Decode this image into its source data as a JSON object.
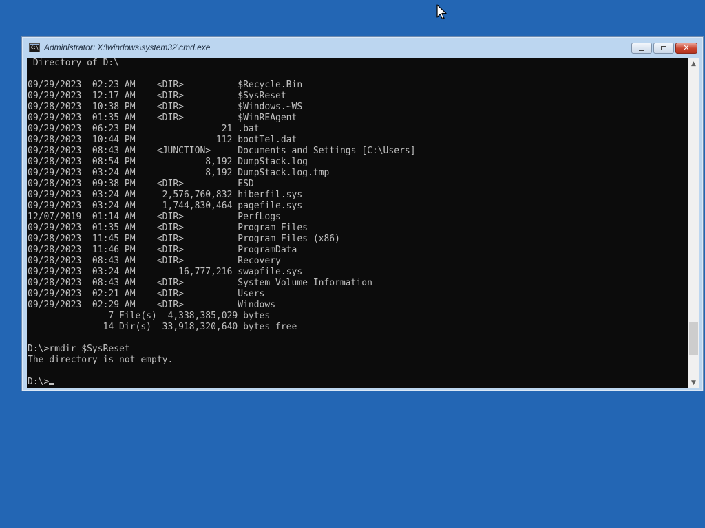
{
  "window": {
    "title": "Administrator: X:\\windows\\system32\\cmd.exe",
    "icon": "cmd-icon",
    "icon_text": "C:\\"
  },
  "controls": {
    "minimize_icon": "minimize-icon",
    "maximize_icon": "maximize-icon",
    "close_icon": "close-icon",
    "close_glyph": "✕"
  },
  "scrollbar": {
    "up": "▲",
    "down": "▼",
    "position_fraction": 0.92
  },
  "console": {
    "lines": [
      " Directory of D:\\",
      "",
      "09/29/2023  02:23 AM    <DIR>          $Recycle.Bin",
      "09/29/2023  12:17 AM    <DIR>          $SysReset",
      "09/28/2023  10:38 PM    <DIR>          $Windows.~WS",
      "09/29/2023  01:35 AM    <DIR>          $WinREAgent",
      "09/29/2023  06:23 PM                21 .bat",
      "09/28/2023  10:44 PM               112 bootTel.dat",
      "09/28/2023  08:43 AM    <JUNCTION>     Documents and Settings [C:\\Users]",
      "09/28/2023  08:54 PM             8,192 DumpStack.log",
      "09/29/2023  03:24 AM             8,192 DumpStack.log.tmp",
      "09/28/2023  09:38 PM    <DIR>          ESD",
      "09/29/2023  03:24 AM     2,576,760,832 hiberfil.sys",
      "09/29/2023  03:24 AM     1,744,830,464 pagefile.sys",
      "12/07/2019  01:14 AM    <DIR>          PerfLogs",
      "09/29/2023  01:35 AM    <DIR>          Program Files",
      "09/28/2023  11:45 PM    <DIR>          Program Files (x86)",
      "09/28/2023  11:46 PM    <DIR>          ProgramData",
      "09/28/2023  08:43 AM    <DIR>          Recovery",
      "09/29/2023  03:24 AM        16,777,216 swapfile.sys",
      "09/28/2023  08:43 AM    <DIR>          System Volume Information",
      "09/29/2023  02:21 AM    <DIR>          Users",
      "09/29/2023  02:29 AM    <DIR>          Windows",
      "               7 File(s)  4,338,385,029 bytes",
      "              14 Dir(s)  33,918,320,640 bytes free",
      "",
      "D:\\>rmdir $SysReset",
      "The directory is not empty.",
      ""
    ],
    "prompt": "D:\\>"
  }
}
